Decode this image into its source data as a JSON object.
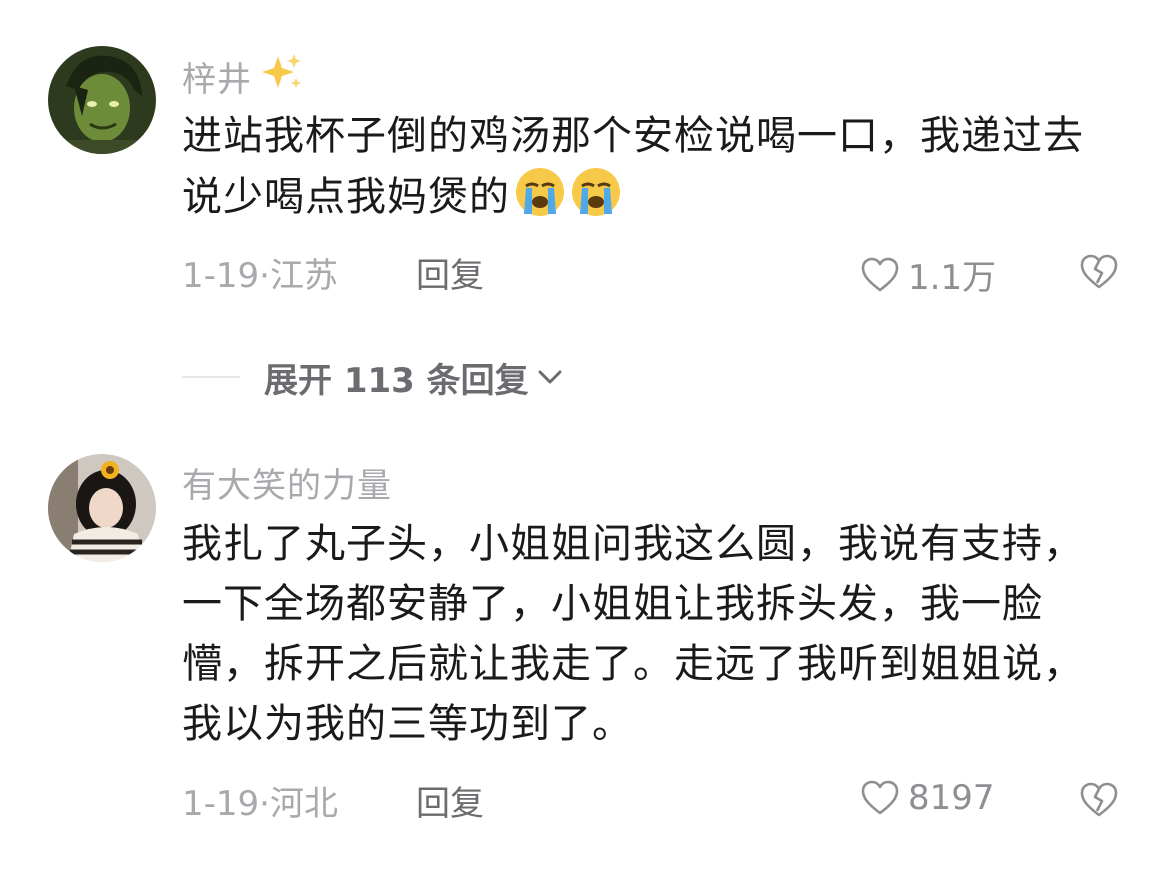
{
  "comments": [
    {
      "username": "梓井",
      "username_icon": "sparkles-icon",
      "text": "进站我杯子倒的鸡汤那个安检说喝一口，我递过去说少喝点我妈煲的",
      "emoji": [
        "loudly-crying-face-icon",
        "loudly-crying-face-icon"
      ],
      "date_location": "1-19·江苏",
      "reply_label": "回复",
      "like_count": "1.1万"
    },
    {
      "username": "有大笑的力量",
      "text": "我扎了丸子头，小姐姐问我这么圆，我说有支持，一下全场都安静了，小姐姐让我拆头发，我一脸懵，拆开之后就让我走了。走远了我听到姐姐说，我以为我的三等功到了。",
      "date_location": "1-19·河北",
      "reply_label": "回复",
      "like_count": "8197"
    }
  ],
  "expand_replies": {
    "label": "展开 113 条回复"
  },
  "colors": {
    "meta_gray": "#a8a8ad",
    "text_dark": "#1a1a1a",
    "action_gray": "#6b6b70",
    "emoji_yellow": "#f7c948",
    "emoji_tear": "#4fa8e8"
  }
}
